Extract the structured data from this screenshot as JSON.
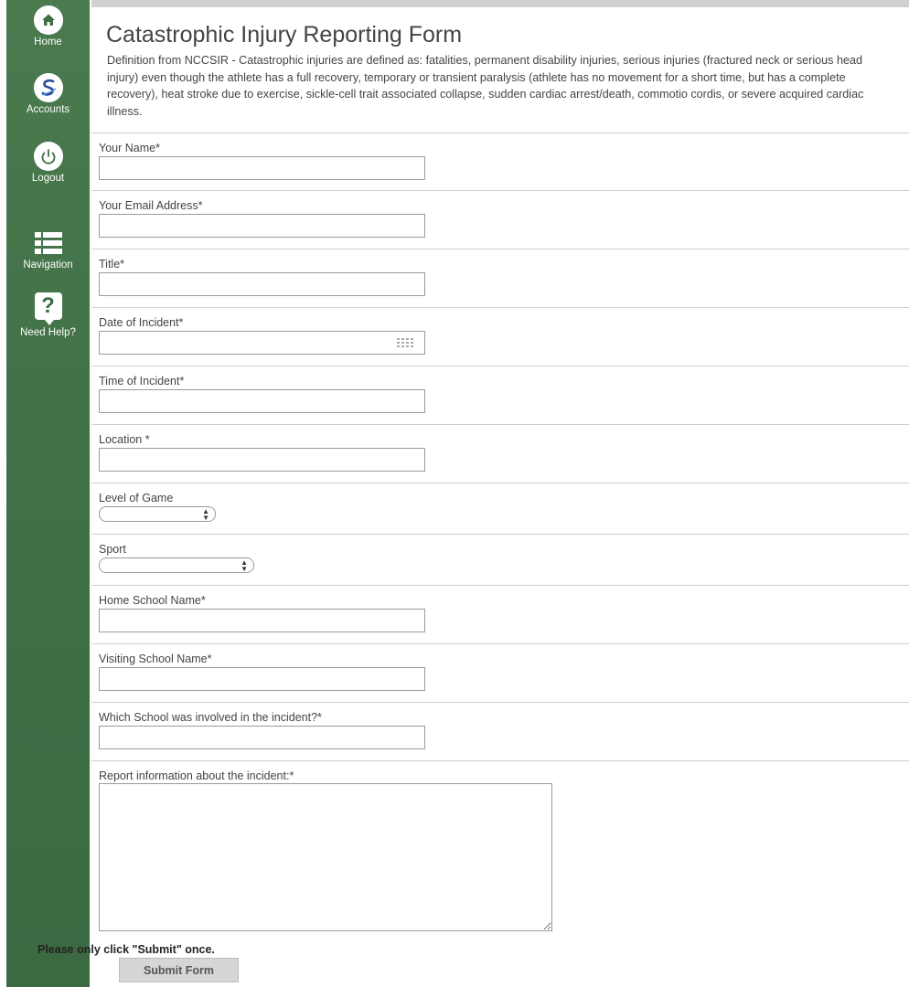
{
  "sidebar": {
    "items": [
      {
        "label": "Home",
        "icon": "home-icon"
      },
      {
        "label": "Accounts",
        "icon": "accounts-logo-icon"
      },
      {
        "label": "Logout",
        "icon": "power-icon"
      },
      {
        "label": "Navigation",
        "icon": "list-icon"
      },
      {
        "label": "Need Help?",
        "icon": "help-icon"
      }
    ],
    "color": "#3f6e45"
  },
  "form": {
    "title": "Catastrophic Injury Reporting Form",
    "definition": "Definition from NCCSIR - Catastrophic injuries are defined as: fatalities, permanent disability injuries, serious injuries (fractured neck or serious head injury) even though the athlete has a full recovery, temporary or transient paralysis (athlete has no movement for a short time, but has a complete recovery), heat stroke due to exercise, sickle-cell trait associated collapse, sudden cardiac arrest/death, commotio cordis, or severe acquired cardiac illness.",
    "fields": {
      "your_name": {
        "label": "Your Name*",
        "value": ""
      },
      "email": {
        "label": "Your Email Address*",
        "value": ""
      },
      "title": {
        "label": "Title*",
        "value": ""
      },
      "date": {
        "label": "Date of Incident*",
        "value": ""
      },
      "time": {
        "label": "Time of Incident*",
        "value": ""
      },
      "location": {
        "label": "Location *",
        "value": ""
      },
      "level": {
        "label": "Level of Game",
        "selected": ""
      },
      "sport": {
        "label": "Sport",
        "selected": ""
      },
      "home_school": {
        "label": "Home School Name*",
        "value": ""
      },
      "visiting_school": {
        "label": "Visiting School Name*",
        "value": ""
      },
      "involved_school": {
        "label": "Which School was involved in the incident?*",
        "value": ""
      },
      "report": {
        "label": "Report information about the incident:*",
        "value": ""
      }
    },
    "submit_note": "Please only click \"Submit\" once.",
    "submit_label": "Submit Form"
  }
}
